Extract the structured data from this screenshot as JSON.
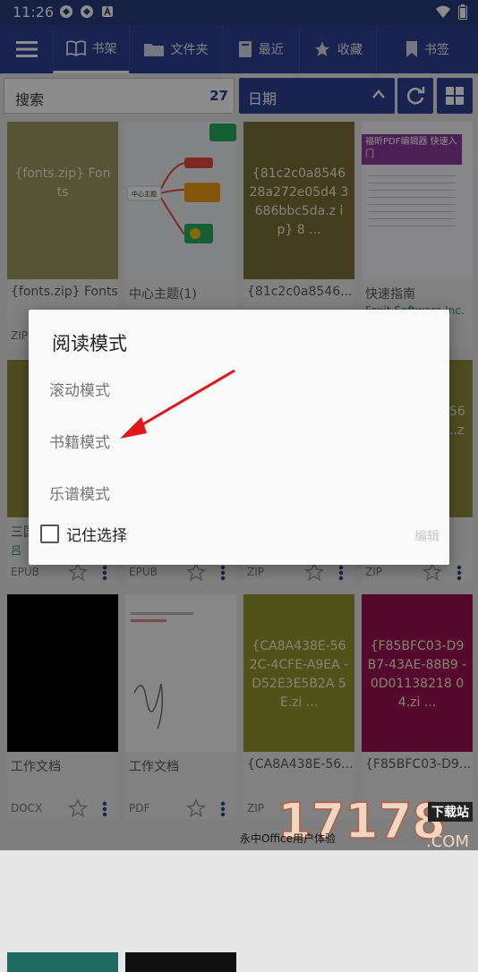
{
  "status": {
    "time": "11:26"
  },
  "toolbar": {
    "tabs": [
      {
        "label": "书架",
        "icon": "book-icon"
      },
      {
        "label": "文件夹",
        "icon": "folder-icon"
      },
      {
        "label": "最近",
        "icon": "recent-icon"
      },
      {
        "label": "收藏",
        "icon": "star-icon"
      },
      {
        "label": "书签",
        "icon": "bookmark-icon"
      }
    ]
  },
  "search": {
    "label": "搜索",
    "count": "27"
  },
  "sort": {
    "label": "日期"
  },
  "books": [
    {
      "title": "{fonts.zip} Fonts",
      "cover_text": "{fonts.zip} Fonts",
      "format": "ZIP",
      "cover_color": "#9d9763"
    },
    {
      "title": "中心主题(1)",
      "cover_text": "中心主题",
      "format": "",
      "cover_color": "#eef0f4"
    },
    {
      "title": "{81c2c0a8546...",
      "cover_text": "{81c2c0a8546 28a272e05d4 3686bbc5da.z ip} 8 ...",
      "format": "",
      "cover_color": "#7a6d3a"
    },
    {
      "title": "快速指南",
      "subtitle": "Foxit Software Inc.",
      "cover_text": "福昕PDF编辑器 快速入门",
      "format": "",
      "cover_color": "#f4f2f6"
    },
    {
      "title": "三国演义",
      "subtitle": "吕",
      "format": "EPUB",
      "cover_color": "#8e8c3c"
    },
    {
      "title": "",
      "format": "EPUB",
      "cover_color": "#8e8c3c"
    },
    {
      "title": "",
      "format": "ZIP",
      "cover_color": "#8e8c3c"
    },
    {
      "title": "",
      "cover_text": "56 ..z",
      "format": "ZIP",
      "cover_color": "#8e8c3c"
    },
    {
      "title": "工作文档",
      "format": "DOCX",
      "cover_color": "#050505"
    },
    {
      "title": "工作文档",
      "format": "PDF",
      "cover_color": "#f6f6f6"
    },
    {
      "title": "{CA8A438E-56...",
      "cover_text": "{CA8A438E-56 2C-4CFE-A9EA -D52E3E5B2A 5E.zi ...",
      "format": "ZIP",
      "cover_color": "#94962e"
    },
    {
      "title": "{F85BFC03-D9...",
      "cover_text": "{F85BFC03-D9 B7-43AE-88B9 -0D01138218 04.zi ...",
      "format": "",
      "cover_color": "#9a1152"
    }
  ],
  "dialog": {
    "title": "阅读模式",
    "options": [
      "滚动模式",
      "书籍模式",
      "乐谱模式"
    ],
    "remember": "记住选择",
    "edit": "编辑"
  },
  "watermark": {
    "brand": "17178",
    "sub": "永中Office用户体验",
    "download": "下载站",
    "domain": ".COM"
  },
  "colors": {
    "primary": "#2c4090",
    "status_bar": "#283b7e",
    "arrow": "#e0161b"
  }
}
